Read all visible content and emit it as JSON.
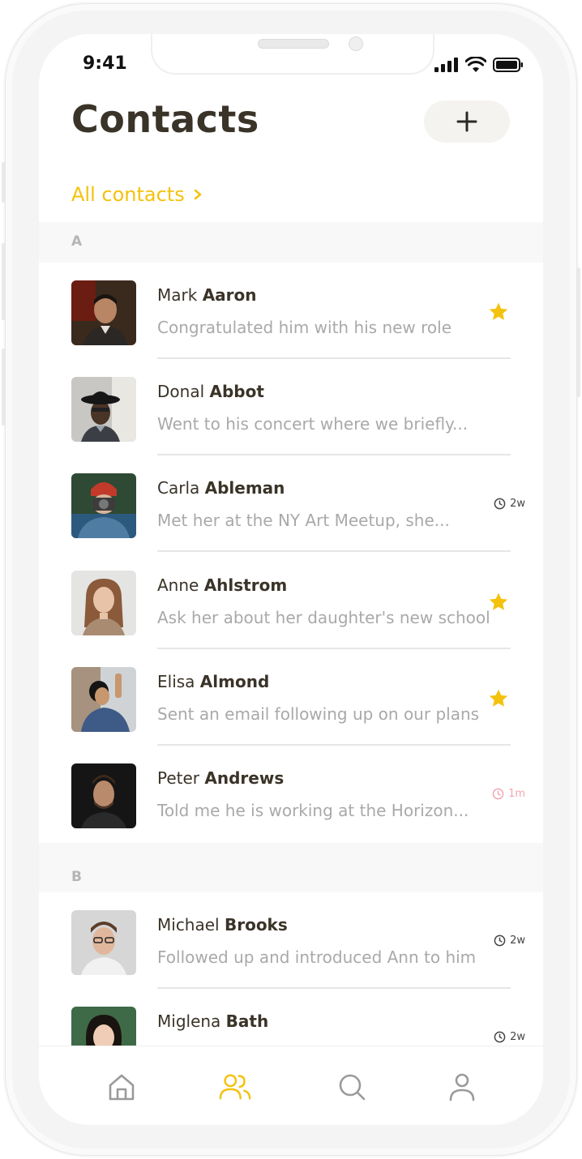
{
  "status": {
    "time": "9:41"
  },
  "header": {
    "title": "Contacts",
    "add_icon": "plus-icon"
  },
  "filter": {
    "label": "All contacts"
  },
  "sections": [
    {
      "letter": "A",
      "contacts": [
        {
          "first": "Mark",
          "last": "Aaron",
          "note": "Congratulated him with his new role",
          "indicator": "star"
        },
        {
          "first": "Donal",
          "last": "Abbot",
          "note": "Went to his concert where we briefly...",
          "indicator": ""
        },
        {
          "first": "Carla",
          "last": "Ableman",
          "note": "Met her at the NY Art Meetup, she...",
          "indicator": "clock",
          "age": "2w"
        },
        {
          "first": "Anne",
          "last": "Ahlstrom",
          "note": "Ask her about her daughter's new school",
          "indicator": "star"
        },
        {
          "first": "Elisa",
          "last": "Almond",
          "note": "Sent an email following up on our plans",
          "indicator": "star"
        },
        {
          "first": "Peter",
          "last": "Andrews",
          "note": "Told me he is working at the Horizon...",
          "indicator": "clock-alert",
          "age": "1m"
        }
      ]
    },
    {
      "letter": "B",
      "contacts": [
        {
          "first": "Michael",
          "last": "Brooks",
          "note": "Followed up and introduced Ann to him",
          "indicator": "clock",
          "age": "2w"
        },
        {
          "first": "Miglena",
          "last": "Bath",
          "note": "",
          "indicator": "clock",
          "age": "2w"
        }
      ]
    }
  ],
  "tabs": [
    {
      "name": "home",
      "icon": "home-icon",
      "active": false
    },
    {
      "name": "contacts",
      "icon": "people-icon",
      "active": true
    },
    {
      "name": "search",
      "icon": "search-icon",
      "active": false
    },
    {
      "name": "profile",
      "icon": "user-icon",
      "active": false
    }
  ],
  "colors": {
    "accent": "#f4c20d",
    "text": "#3a3328",
    "muted": "#a9a9a9",
    "alert": "#f2a6b3"
  }
}
